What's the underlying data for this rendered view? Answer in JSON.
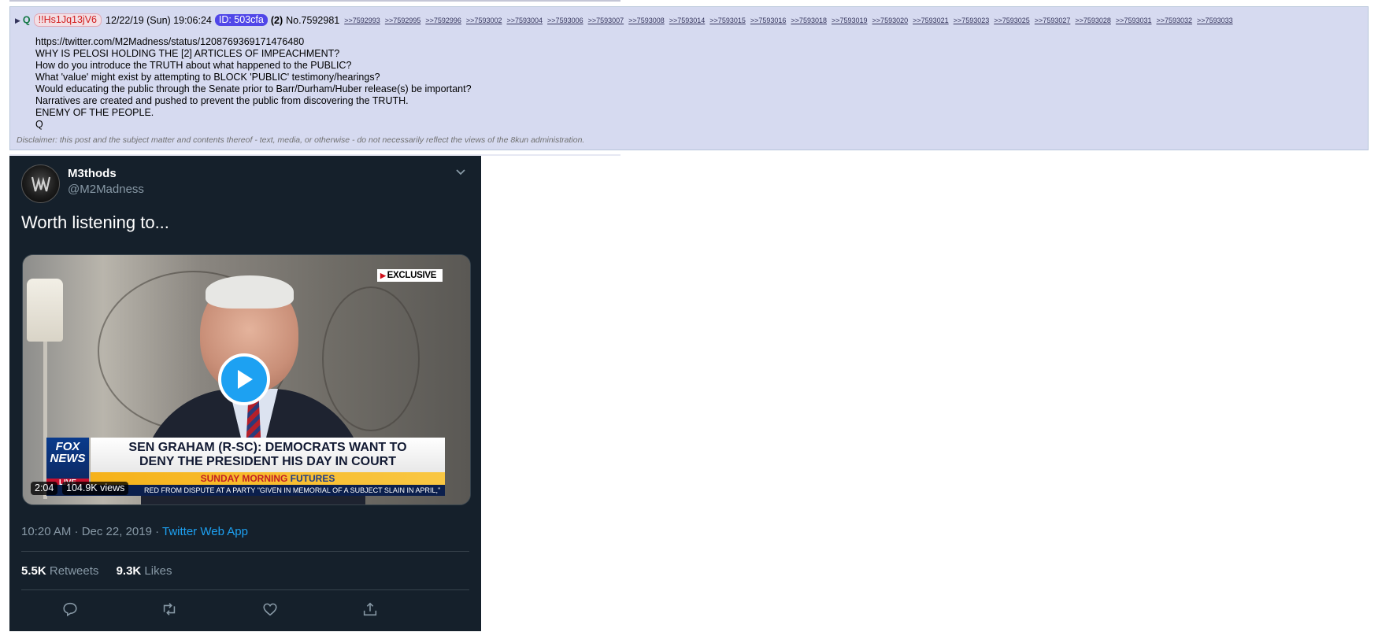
{
  "post": {
    "name": "Q",
    "tripcode": "!!Hs1Jq13jV6",
    "datetime": "12/22/19 (Sun) 19:06:24",
    "id": "ID: 503cfa",
    "count": "(2)",
    "number": "No.7592981",
    "replies": [
      ">>7592993",
      ">>7592995",
      ">>7592996",
      ">>7593002",
      ">>7593004",
      ">>7593006",
      ">>7593007",
      ">>7593008",
      ">>7593014",
      ">>7593015",
      ">>7593016",
      ">>7593018",
      ">>7593019",
      ">>7593020",
      ">>7593021",
      ">>7593023",
      ">>7593025",
      ">>7593027",
      ">>7593028",
      ">>7593031",
      ">>7593032",
      ">>7593033"
    ],
    "lines": [
      "https://twitter.com/M2Madness/status/1208769369171476480",
      "WHY IS PELOSI HOLDING THE [2] ARTICLES OF IMPEACHMENT?",
      "How do you introduce the TRUTH about what happened to the PUBLIC?",
      "What 'value' might exist by attempting to BLOCK 'PUBLIC' testimony/hearings?",
      "Would educating the public through the Senate prior to Barr/Durham/Huber release(s) be important?",
      "Narratives are created and pushed to prevent the public from discovering the TRUTH.",
      "ENEMY OF THE PEOPLE.",
      "Q"
    ],
    "disclaimer": "Disclaimer: this post and the subject matter and contents thereof - text, media, or otherwise - do not necessarily reflect the views of the 8kun administration."
  },
  "tweet": {
    "display_name": "M3thods",
    "handle": "@M2Madness",
    "text": "Worth listening to...",
    "video": {
      "exclusive": "EXCLUSIVE",
      "network": [
        "FOX",
        "NEWS"
      ],
      "live": "LIVE",
      "headline_1": "SEN GRAHAM (R-SC): DEMOCRATS WANT TO",
      "headline_2": "DENY THE PRESIDENT HIS DAY IN COURT",
      "show_1": "SUNDAY MORNING",
      "show_2": "FUTURES",
      "ticker": "RED FROM DISPUTE AT A PARTY \"GIVEN IN MEMORIAL OF A SUBJECT SLAIN IN APRIL,\"",
      "duration": "2:04",
      "views": "104.9K views"
    },
    "time": "10:20 AM · Dec 22, 2019 · ",
    "source": "Twitter Web App",
    "retweets": "5.5K",
    "retweets_label": "Retweets",
    "likes": "9.3K",
    "likes_label": "Likes",
    "accent": "#1da1f2",
    "background": "#15202b",
    "icons": [
      "reply-icon",
      "retweet-icon",
      "like-icon",
      "share-icon"
    ]
  }
}
